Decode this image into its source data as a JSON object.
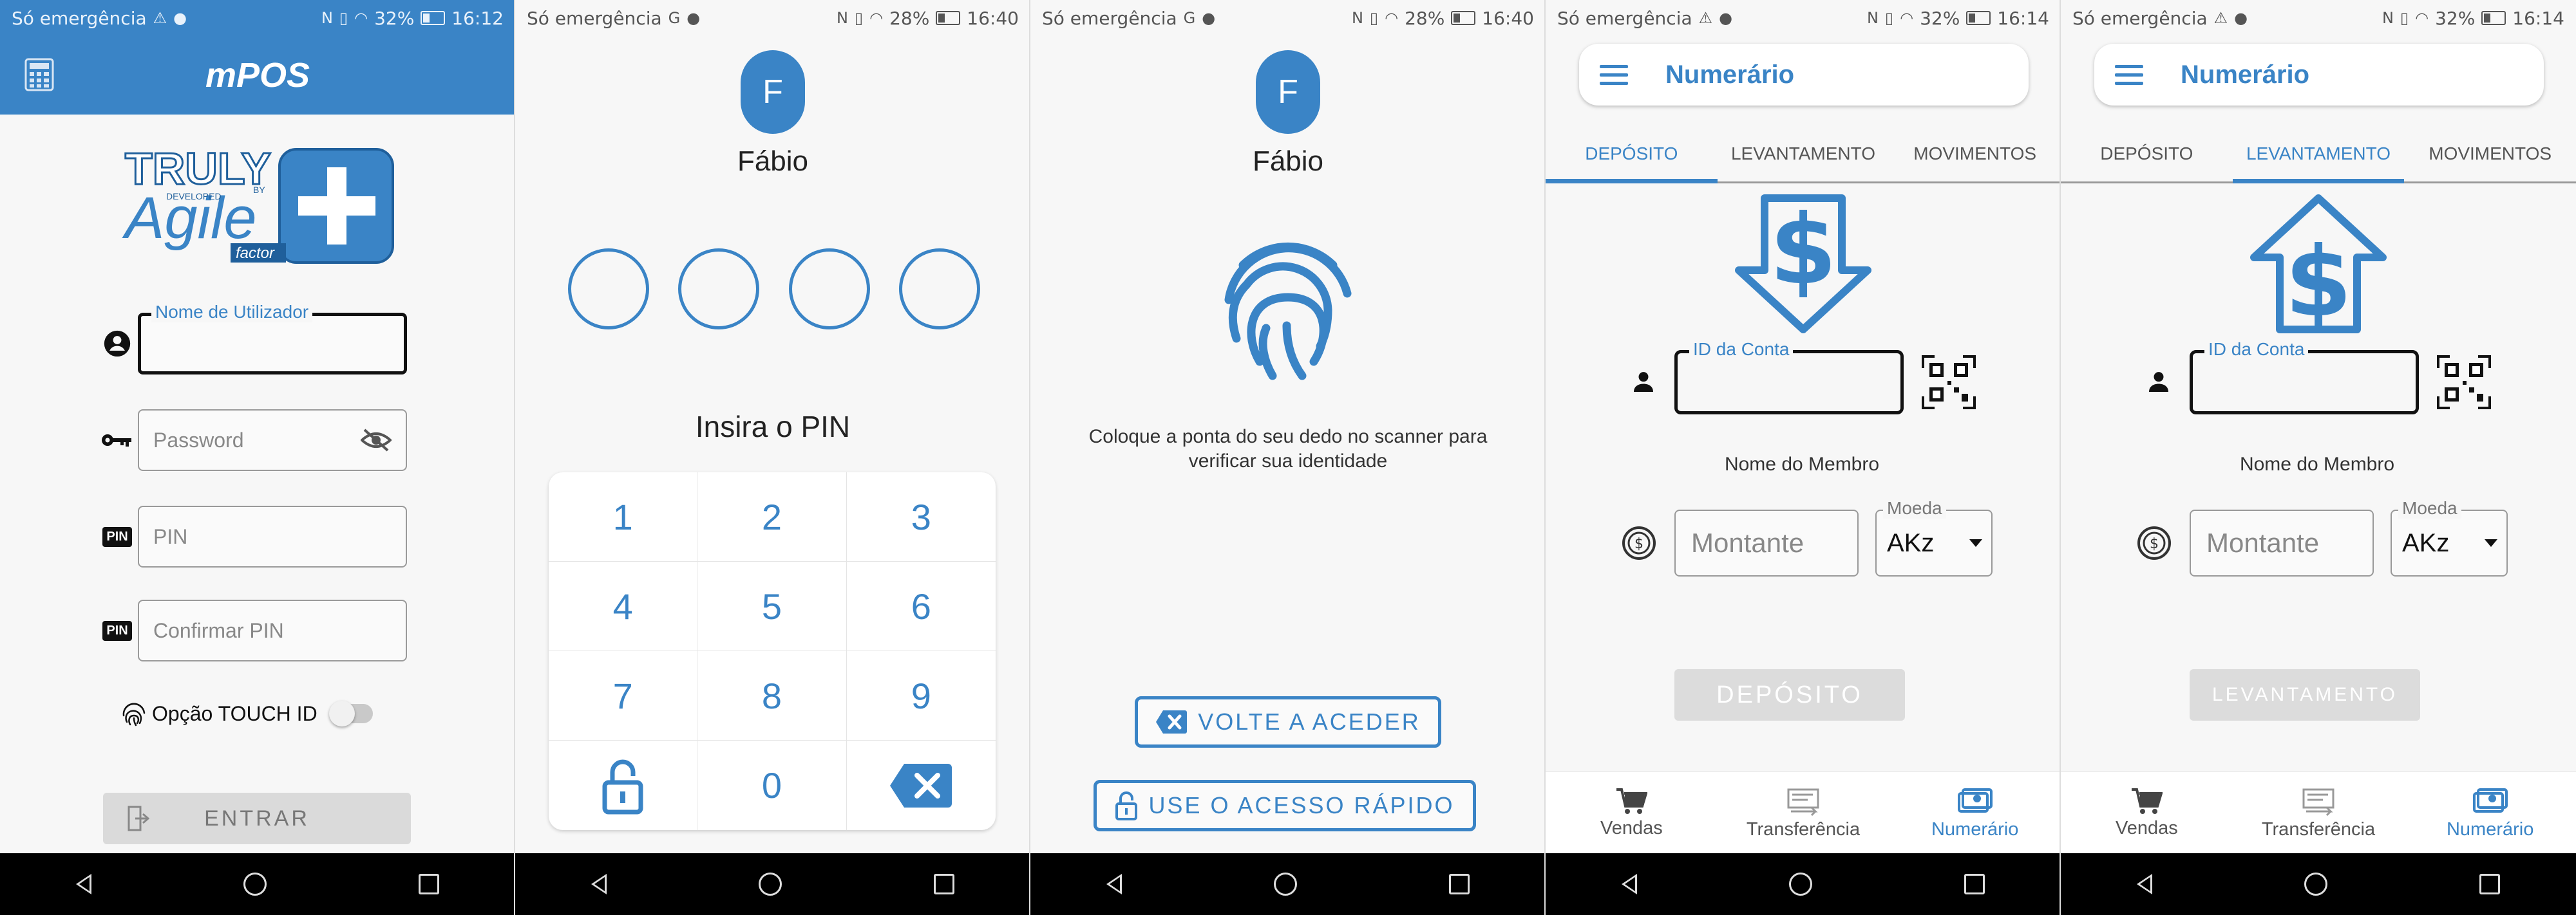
{
  "colors": {
    "primary": "#3a84c6",
    "dark": "#111111",
    "disabled": "#dcdcdc"
  },
  "status": {
    "carrier_text": "Só emergência",
    "s1": {
      "battery": "32%",
      "time": "16:12"
    },
    "s2": {
      "battery": "28%",
      "time": "16:40"
    },
    "s3": {
      "battery": "28%",
      "time": "16:40"
    },
    "s4": {
      "battery": "32%",
      "time": "16:14"
    },
    "s5": {
      "battery": "32%",
      "time": "16:14"
    }
  },
  "login": {
    "title": "mPOS",
    "logo_text": {
      "truly": "TRULY",
      "agile": "Agile",
      "developed": "DEVELOPED",
      "by": "BY",
      "factor": "factor"
    },
    "username_label": "Nome de Utilizador",
    "password_placeholder": "Password",
    "pin_placeholder": "PIN",
    "confirm_pin_placeholder": "Confirmar PIN",
    "pin_badge": "PIN",
    "touch_id_label": "Opção TOUCH ID",
    "enter_button": "ENTRAR"
  },
  "pin_screen": {
    "avatar_letter": "F",
    "user_name": "Fábio",
    "prompt": "Insira o PIN",
    "keys": [
      "1",
      "2",
      "3",
      "4",
      "5",
      "6",
      "7",
      "8",
      "9",
      "0"
    ]
  },
  "fingerprint_screen": {
    "avatar_letter": "F",
    "user_name": "Fábio",
    "message": "Coloque a ponta do seu dedo no scanner para verificar sua identidade",
    "back_button": "VOLTE A ACEDER",
    "quick_access_button": "USE O ACESSO RÁPIDO"
  },
  "numerario_deposit": {
    "title": "Numerário",
    "tabs": [
      "DEPÓSITO",
      "LEVANTAMENTO",
      "MOVIMENTOS"
    ],
    "active_tab": 0,
    "account_label": "ID da Conta",
    "member_name_label": "Nome do Membro",
    "amount_placeholder": "Montante",
    "currency_label": "Moeda",
    "currency_value": "AKz",
    "action_button": "DEPÓSITO",
    "bottom_nav": [
      "Vendas",
      "Transferência",
      "Numerário"
    ],
    "active_nav": 2
  },
  "numerario_withdraw": {
    "title": "Numerário",
    "tabs": [
      "DEPÓSITO",
      "LEVANTAMENTO",
      "MOVIMENTOS"
    ],
    "active_tab": 1,
    "account_label": "ID da Conta",
    "member_name_label": "Nome do Membro",
    "amount_placeholder": "Montante",
    "currency_label": "Moeda",
    "currency_value": "AKz",
    "action_button": "LEVANTAMENTO",
    "bottom_nav": [
      "Vendas",
      "Transferência",
      "Numerário"
    ],
    "active_nav": 2
  }
}
